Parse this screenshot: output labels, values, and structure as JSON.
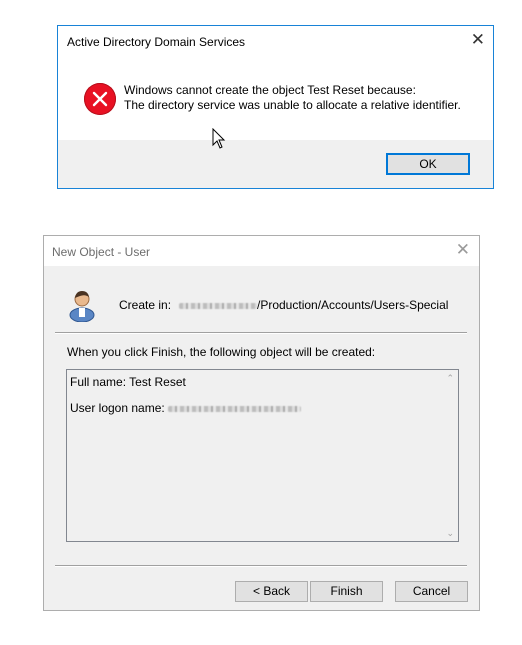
{
  "error_dialog": {
    "title": "Active Directory Domain Services",
    "close_glyph": "✕",
    "message_line1": "Windows cannot create the object Test Reset because:",
    "message_line2": "The directory service was unable to allocate a relative identifier.",
    "ok_label": "OK",
    "icon": "error-icon",
    "icon_color": "#e81123",
    "border_color": "#1883d7"
  },
  "new_object_dialog": {
    "title": "New Object - User",
    "close_glyph": "✕",
    "icon": "user-icon",
    "create_in_label": "Create in:",
    "create_in_path_visible": "/Production/Accounts/Users-Special",
    "finish_message": "When you click Finish, the following object will be created:",
    "summary": {
      "full_name": "Full name: Test Reset",
      "logon_label": "User logon name:"
    },
    "buttons": {
      "back": "< Back",
      "finish": "Finish",
      "cancel": "Cancel"
    }
  }
}
